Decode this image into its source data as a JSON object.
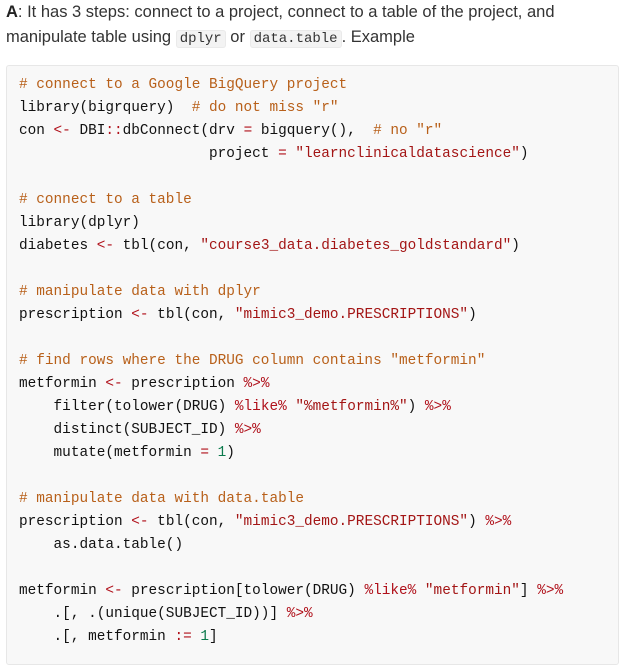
{
  "answer": {
    "label": "A",
    "text1": ": It has 3 steps: connect to a project, connect to a table of the project, and manipulate table using ",
    "code1": "dplyr",
    "text2": " or ",
    "code2": "data.table",
    "text3": ". Example"
  },
  "colors": {
    "comment": "#b8601a",
    "operator": "#b0101a",
    "string": "#a31515",
    "number": "#0b7a4c",
    "code_bg": "#f8f8f8"
  },
  "code": {
    "lines": [
      [
        [
          "c",
          "# connect to a Google BigQuery project"
        ]
      ],
      [
        [
          "p",
          "library(bigrquery)  "
        ],
        [
          "c",
          "# do not miss \"r\""
        ]
      ],
      [
        [
          "p",
          "con "
        ],
        [
          "o",
          "<-"
        ],
        [
          "p",
          " DBI"
        ],
        [
          "o",
          "::"
        ],
        [
          "p",
          "dbConnect(drv "
        ],
        [
          "o",
          "="
        ],
        [
          "p",
          " bigquery(),  "
        ],
        [
          "c",
          "# no \"r\""
        ]
      ],
      [
        [
          "p",
          "                      project "
        ],
        [
          "o",
          "="
        ],
        [
          "p",
          " "
        ],
        [
          "s",
          "\"learnclinicaldatascience\""
        ],
        [
          "p",
          ")"
        ]
      ],
      [],
      [
        [
          "c",
          "# connect to a table"
        ]
      ],
      [
        [
          "p",
          "library(dplyr)"
        ]
      ],
      [
        [
          "p",
          "diabetes "
        ],
        [
          "o",
          "<-"
        ],
        [
          "p",
          " tbl(con, "
        ],
        [
          "s",
          "\"course3_data.diabetes_goldstandard\""
        ],
        [
          "p",
          ")"
        ]
      ],
      [],
      [
        [
          "c",
          "# manipulate data with dplyr"
        ]
      ],
      [
        [
          "p",
          "prescription "
        ],
        [
          "o",
          "<-"
        ],
        [
          "p",
          " tbl(con, "
        ],
        [
          "s",
          "\"mimic3_demo.PRESCRIPTIONS\""
        ],
        [
          "p",
          ")"
        ]
      ],
      [],
      [
        [
          "c",
          "# find rows where the DRUG column contains \"metformin\""
        ]
      ],
      [
        [
          "p",
          "metformin "
        ],
        [
          "o",
          "<-"
        ],
        [
          "p",
          " prescription "
        ],
        [
          "o",
          "%>%"
        ]
      ],
      [
        [
          "p",
          "    filter(tolower(DRUG) "
        ],
        [
          "o",
          "%like%"
        ],
        [
          "p",
          " "
        ],
        [
          "s",
          "\"%metformin%\""
        ],
        [
          "p",
          ") "
        ],
        [
          "o",
          "%>%"
        ]
      ],
      [
        [
          "p",
          "    distinct(SUBJECT_ID) "
        ],
        [
          "o",
          "%>%"
        ]
      ],
      [
        [
          "p",
          "    mutate(metformin "
        ],
        [
          "o",
          "="
        ],
        [
          "p",
          " "
        ],
        [
          "n",
          "1"
        ],
        [
          "p",
          ")"
        ]
      ],
      [],
      [
        [
          "c",
          "# manipulate data with data.table"
        ]
      ],
      [
        [
          "p",
          "prescription "
        ],
        [
          "o",
          "<-"
        ],
        [
          "p",
          " tbl(con, "
        ],
        [
          "s",
          "\"mimic3_demo.PRESCRIPTIONS\""
        ],
        [
          "p",
          ") "
        ],
        [
          "o",
          "%>%"
        ]
      ],
      [
        [
          "p",
          "    as.data.table()"
        ]
      ],
      [],
      [
        [
          "p",
          "metformin "
        ],
        [
          "o",
          "<-"
        ],
        [
          "p",
          " prescription[tolower(DRUG) "
        ],
        [
          "o",
          "%like%"
        ],
        [
          "p",
          " "
        ],
        [
          "s",
          "\"metformin\""
        ],
        [
          "p",
          "] "
        ],
        [
          "o",
          "%>%"
        ]
      ],
      [
        [
          "p",
          "    .[, .(unique(SUBJECT_ID))] "
        ],
        [
          "o",
          "%>%"
        ]
      ],
      [
        [
          "p",
          "    .[, metformin "
        ],
        [
          "o",
          ":="
        ],
        [
          "p",
          " "
        ],
        [
          "n",
          "1"
        ],
        [
          "p",
          "]"
        ]
      ]
    ]
  }
}
